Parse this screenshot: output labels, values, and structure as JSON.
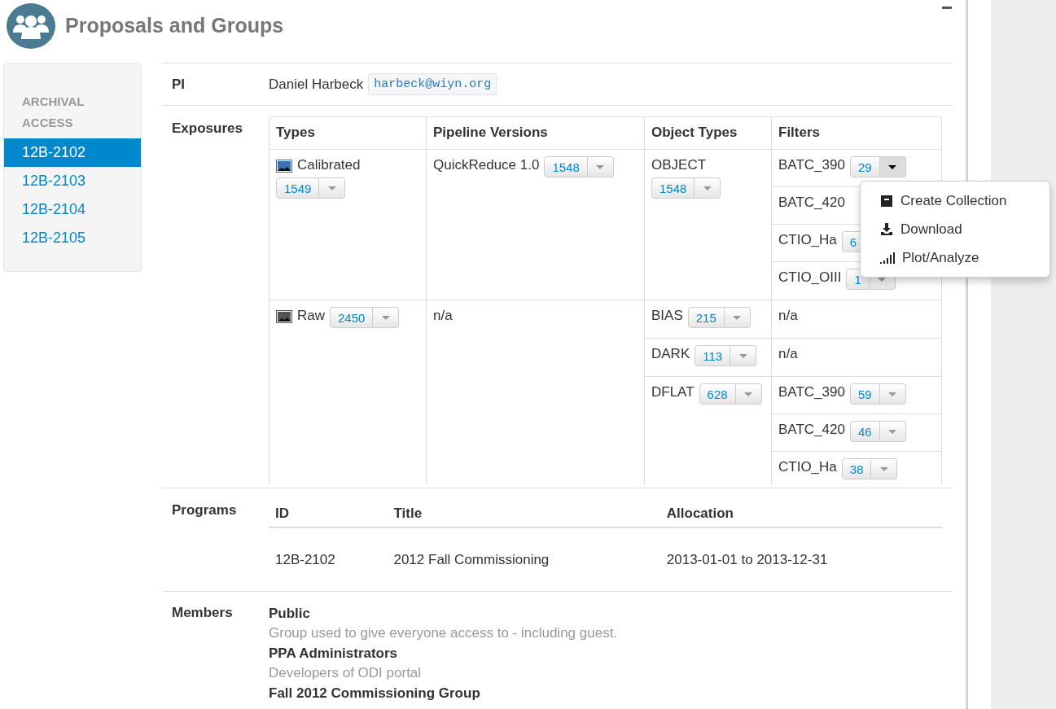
{
  "header": {
    "title": "Proposals and Groups"
  },
  "sidebar": {
    "heading": "ARCHIVAL ACCESS",
    "items": [
      {
        "label": "12B-2102",
        "selected": true
      },
      {
        "label": "12B-2103",
        "selected": false
      },
      {
        "label": "12B-2104",
        "selected": false
      },
      {
        "label": "12B-2105",
        "selected": false
      }
    ]
  },
  "pi": {
    "label": "PI",
    "name": "Daniel Harbeck",
    "email": "harbeck@wiyn.org"
  },
  "exposures": {
    "label": "Exposures",
    "columns": [
      "Types",
      "Pipeline Versions",
      "Object Types",
      "Filters"
    ],
    "rows": [
      {
        "type": "Calibrated",
        "color": "#3b6fb0",
        "count": "1549",
        "pipeline": "QuickReduce 1.0",
        "pipeline_count": "1548",
        "objects": [
          {
            "name": "OBJECT",
            "count": "1548",
            "filters": [
              {
                "name": "BATC_390",
                "count": "29",
                "open": true
              },
              {
                "name": "BATC_420"
              },
              {
                "name": "CTIO_Ha",
                "count": "6"
              },
              {
                "name": "CTIO_OIII",
                "count": "1",
                "open": false
              }
            ]
          }
        ]
      },
      {
        "type": "Raw",
        "color": "#555555",
        "count": "2450",
        "pipeline": "n/a",
        "objects": [
          {
            "name": "BIAS",
            "count": "215",
            "filters": [
              {
                "name": "n/a"
              }
            ]
          },
          {
            "name": "DARK",
            "count": "113",
            "filters": [
              {
                "name": "n/a"
              }
            ]
          },
          {
            "name": "DFLAT",
            "count": "628",
            "filters": [
              {
                "name": "BATC_390",
                "count": "59",
                "open": false
              },
              {
                "name": "BATC_420",
                "count": "46",
                "open": false
              },
              {
                "name": "CTIO_Ha",
                "count": "38",
                "open": false
              }
            ]
          }
        ]
      }
    ]
  },
  "menu": {
    "items": [
      {
        "label": "Create Collection",
        "kind": "archive"
      },
      {
        "label": "Download",
        "kind": "download"
      },
      {
        "label": "Plot/Analyze",
        "kind": "bars"
      }
    ]
  },
  "programs": {
    "label": "Programs",
    "columns": [
      "ID",
      "Title",
      "Allocation"
    ],
    "rows": [
      [
        "12B-2102",
        "2012 Fall Commissioning",
        "2013-01-01 to 2013-12-31"
      ]
    ]
  },
  "members": {
    "label": "Members",
    "groups": [
      {
        "name": "Public",
        "description": "Group used to give everyone access to - including guest."
      },
      {
        "name": "PPA Administrators",
        "description": "Developers of ODI portal"
      },
      {
        "name": "Fall 2012 Commissioning Group"
      }
    ]
  }
}
